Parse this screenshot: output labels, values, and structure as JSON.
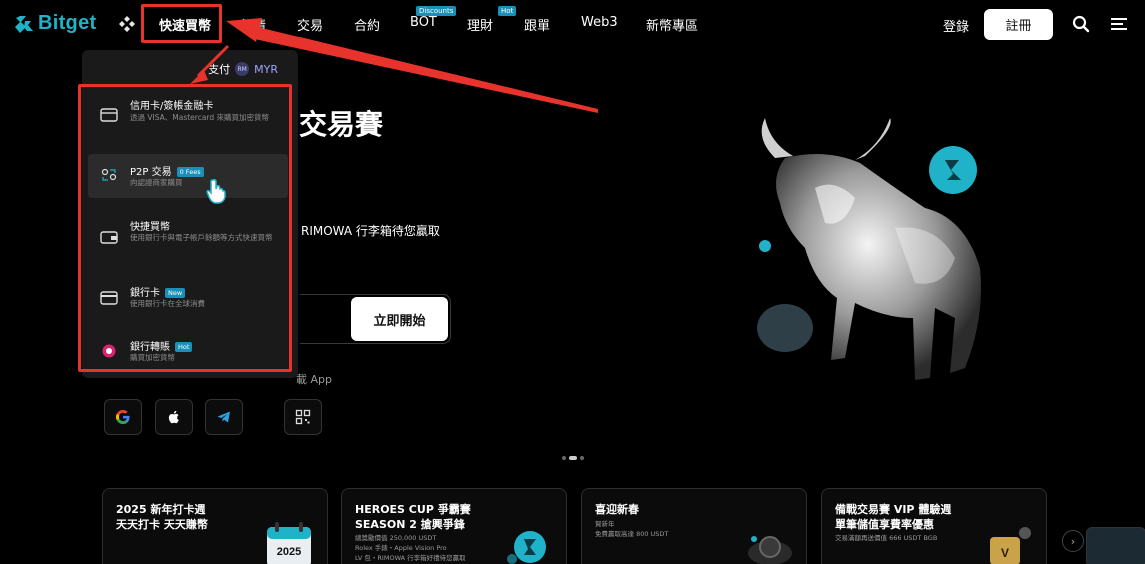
{
  "nav": {
    "brand": "Bitget",
    "items": [
      {
        "label": "快速買幣",
        "badge": ""
      },
      {
        "label": "行情",
        "badge": ""
      },
      {
        "label": "交易",
        "badge": ""
      },
      {
        "label": "合約",
        "badge": ""
      },
      {
        "label": "BOT",
        "badge": "Discounts"
      },
      {
        "label": "理財",
        "badge": "Hot"
      },
      {
        "label": "跟單",
        "badge": ""
      },
      {
        "label": "Web3",
        "badge": ""
      },
      {
        "label": "新幣專區",
        "badge": ""
      }
    ],
    "login": "登錄",
    "register": "註冊"
  },
  "dropdown": {
    "payment_label": "支付",
    "currency_icon": "RM",
    "currency_code": "MYR",
    "items": [
      {
        "title": "信用卡/簽帳金融卡",
        "badge": "",
        "desc": "透過 VISA、Mastercard 來購買加密貨幣",
        "icon": "card-icon"
      },
      {
        "title": "P2P 交易",
        "badge": "0 Fees",
        "desc": "向認證商家購買",
        "icon": "p2p-icon"
      },
      {
        "title": "快捷買幣",
        "badge": "",
        "desc": "使用銀行卡與電子帳戶餘額等方式快速買幣",
        "icon": "wallet-card-icon"
      },
      {
        "title": "銀行卡",
        "badge": "New",
        "desc": "使用銀行卡在全球消費",
        "icon": "bank-card-icon"
      },
      {
        "title": "銀行轉賬",
        "badge": "Hot",
        "desc": "購買加密貨幣",
        "icon": "bank-transfer-icon"
      }
    ]
  },
  "hero": {
    "title": "交易賽",
    "subtitle": "RIMOWA 行李箱待您贏取",
    "cta": "立即開始",
    "app_text": "載 App"
  },
  "promos": [
    {
      "title": "2025 新年打卡週\n天天打卡 天天賺幣",
      "desc": ""
    },
    {
      "title": "HEROES CUP 爭霸賽\nSEASON 2 搶興爭鋒",
      "desc": "總獎勵價值 250,000 USDT\nRolex 手錶・Apple Vision Pro\nLV 包・RIMOWA 行李箱好禮待您贏取"
    },
    {
      "title": "喜迎新春",
      "desc": "賀新年\n免費贏取高達 800 USDT"
    },
    {
      "title": "備戰交易賽 VIP 體驗週\n單筆儲值享費率優惠",
      "desc": "交易滿額再送價值 666 USDT BGB"
    }
  ],
  "calendar_year": "2025",
  "colors": {
    "brand": "#1fb2c9",
    "annotation": "#e8332c",
    "badge": "#1a8fb8"
  }
}
